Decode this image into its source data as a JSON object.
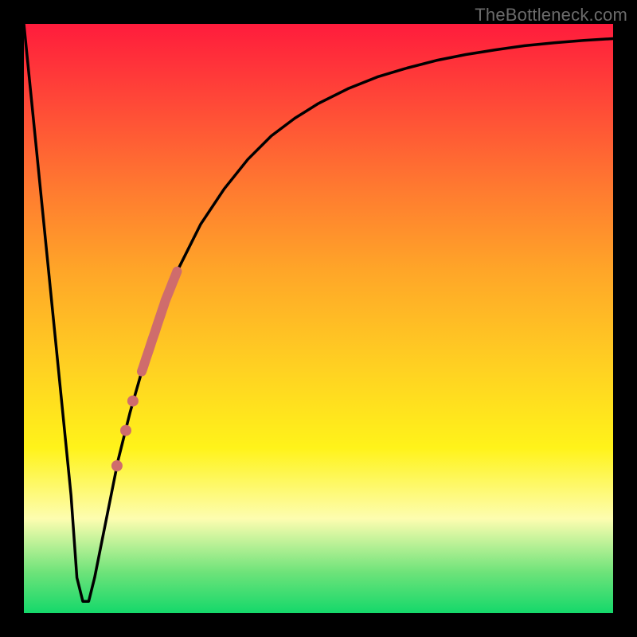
{
  "watermark": "TheBottleneck.com",
  "colors": {
    "frame": "#000000",
    "curve": "#000000",
    "marker": "#cf6c6c",
    "gradient_top": "#ff1c3c",
    "gradient_bottom": "#14d86a"
  },
  "chart_data": {
    "type": "line",
    "title": "",
    "xlabel": "",
    "ylabel": "",
    "xlim": [
      0,
      100
    ],
    "ylim": [
      0,
      100
    ],
    "grid": false,
    "legend": false,
    "series": [
      {
        "name": "bottleneck-curve",
        "x": [
          0,
          2,
          4,
          6,
          8,
          9,
          10,
          11,
          12,
          14,
          16,
          18,
          20,
          22,
          24,
          26,
          28,
          30,
          34,
          38,
          42,
          46,
          50,
          55,
          60,
          65,
          70,
          75,
          80,
          85,
          90,
          95,
          100
        ],
        "y": [
          100,
          80,
          60,
          40,
          20,
          6,
          2,
          2,
          6,
          16,
          26,
          34,
          41,
          47,
          53,
          58,
          62,
          66,
          72,
          77,
          81,
          84,
          86.5,
          89,
          91,
          92.5,
          93.8,
          94.8,
          95.6,
          96.3,
          96.8,
          97.2,
          97.5
        ]
      }
    ],
    "marker_band": {
      "name": "highlight-range",
      "color": "#cf6c6c",
      "x_start": 20,
      "x_end": 26,
      "thickness": 12
    },
    "marker_dots": {
      "name": "highlight-dots",
      "color": "#cf6c6c",
      "points": [
        {
          "x": 18.5,
          "y": 36
        },
        {
          "x": 17.3,
          "y": 31
        },
        {
          "x": 15.8,
          "y": 25
        }
      ],
      "radius": 7
    }
  }
}
